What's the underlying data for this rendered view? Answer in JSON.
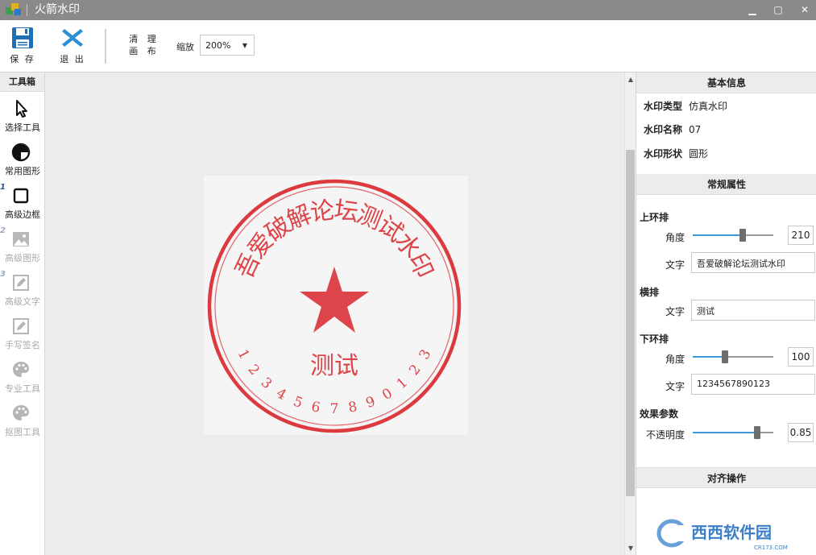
{
  "window": {
    "title": "火箭水印",
    "minimize": "▁",
    "maximize": "▢",
    "close": "✕"
  },
  "toolbar": {
    "save_label": "保 存",
    "exit_label": "退 出",
    "clear_line1": "清 理",
    "clear_line2": "画 布",
    "zoom_label": "缩放",
    "zoom_value": "200%"
  },
  "tools": {
    "header": "工具箱",
    "items": [
      {
        "label": "选择工具",
        "num": "",
        "icon": "cursor-icon",
        "enabled": true
      },
      {
        "label": "常用图形",
        "num": "",
        "icon": "pie-shape-icon",
        "enabled": true
      },
      {
        "label": "高级边框",
        "num": "1",
        "icon": "square-frame-icon",
        "enabled": true
      },
      {
        "label": "高级图形",
        "num": "2",
        "icon": "image-icon",
        "enabled": false
      },
      {
        "label": "高级文字",
        "num": "3",
        "icon": "pencil-icon",
        "enabled": false
      },
      {
        "label": "手写签名",
        "num": "",
        "icon": "pencil-icon",
        "enabled": false
      },
      {
        "label": "专业工具",
        "num": "",
        "icon": "palette-icon",
        "enabled": false
      },
      {
        "label": "抠图工具",
        "num": "",
        "icon": "palette-icon",
        "enabled": false
      }
    ]
  },
  "seal": {
    "top_text": "吾爱破解论坛测试水印",
    "center_text": "测试",
    "bottom_text": "1234567890123",
    "color": "#d9262b"
  },
  "panel": {
    "basic_header": "基本信息",
    "type_label": "水印类型",
    "type_value": "仿真水印",
    "name_label": "水印名称",
    "name_value": "07",
    "shape_label": "水印形状",
    "shape_value": "圆形",
    "props_header": "常规属性",
    "top_ring": {
      "label": "上环排",
      "angle_label": "角度",
      "angle_value": "210",
      "angle_fraction": 0.62,
      "text_label": "文字",
      "text_value": "吾爱破解论坛测试水印"
    },
    "horizontal": {
      "label": "横排",
      "text_label": "文字",
      "text_value": "测试"
    },
    "bottom_ring": {
      "label": "下环排",
      "angle_label": "角度",
      "angle_value": "100",
      "angle_fraction": 0.4,
      "text_label": "文字",
      "text_value": "1234567890123"
    },
    "effects": {
      "label": "效果参数",
      "opacity_label": "不透明度",
      "opacity_value": "0.85",
      "opacity_fraction": 0.8
    },
    "align_header": "对齐操作"
  },
  "watermark": {
    "brand": "西西软件园",
    "url": "CR173.COM"
  },
  "colors": {
    "accent": "#3d9ad6",
    "save_icon": "#1e6fb6",
    "exit_icon": "#2b8fd6",
    "seal_red": "#d9262b"
  }
}
